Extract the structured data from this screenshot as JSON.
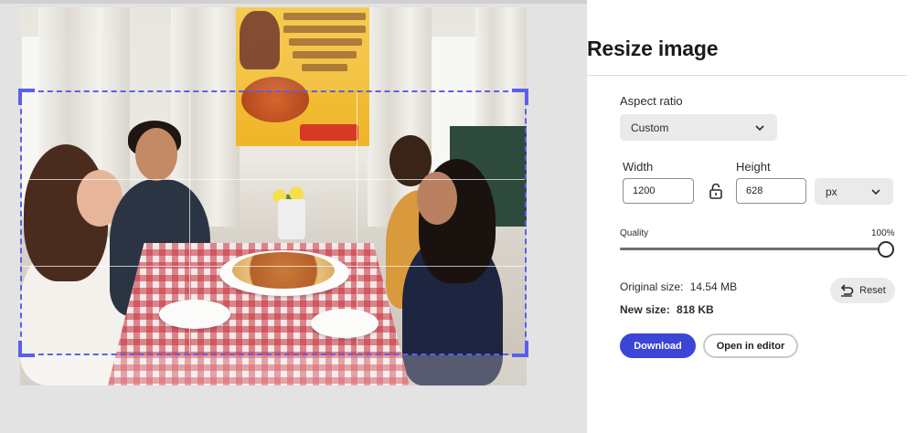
{
  "panel": {
    "title": "Resize image",
    "aspect_ratio": {
      "label": "Aspect ratio",
      "selected": "Custom"
    },
    "width": {
      "label": "Width",
      "value": "1200"
    },
    "height": {
      "label": "Height",
      "value": "628"
    },
    "unit": {
      "selected": "px"
    },
    "quality": {
      "label": "Quality",
      "value_text": "100%",
      "value": 1.0
    },
    "original_size": {
      "label": "Original size:",
      "value": "14.54 MB"
    },
    "new_size": {
      "label": "New size:",
      "value": "818 KB"
    },
    "reset_label": "Reset",
    "download_label": "Download",
    "open_editor_label": "Open in editor"
  },
  "colors": {
    "accent": "#3b46d6",
    "crop_border": "#5a5ff0",
    "canvas_bg": "#e3e3e3"
  },
  "icons": {
    "lock": "unlocked-padlock-icon",
    "reset": "undo-arrow-icon",
    "chevron": "chevron-down-icon"
  }
}
